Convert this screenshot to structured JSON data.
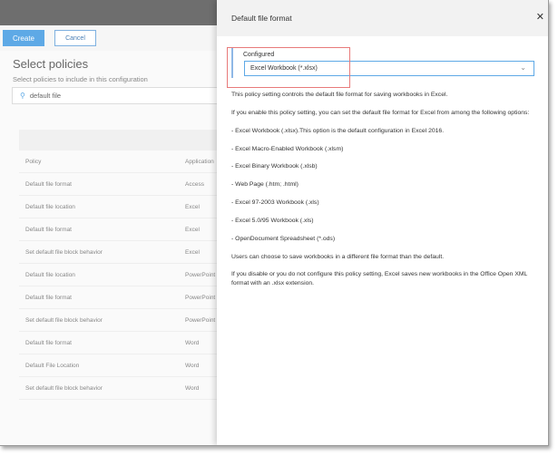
{
  "toolbar": {
    "create": "Create",
    "cancel": "Cancel"
  },
  "page": {
    "title": "Select policies",
    "subtitle": "Select policies to include in this configuration",
    "search_value": "default file"
  },
  "table": {
    "headers": [
      "Policy",
      "Application"
    ],
    "rows": [
      [
        "Default file format",
        "Access"
      ],
      [
        "Default file location",
        "Excel"
      ],
      [
        "Default file format",
        "Excel"
      ],
      [
        "Set default file block behavior",
        "Excel"
      ],
      [
        "Default file location",
        "PowerPoint"
      ],
      [
        "Default file format",
        "PowerPoint"
      ],
      [
        "Set default file block behavior",
        "PowerPoint"
      ],
      [
        "Default file format",
        "Word"
      ],
      [
        "Default File Location",
        "Word"
      ],
      [
        "Set default file block behavior",
        "Word"
      ]
    ]
  },
  "panel": {
    "title": "Default file format",
    "close": "✕",
    "config_label": "Configured",
    "selected": "Excel Workbook (*.xlsx)",
    "paragraphs": [
      "This policy setting controls the default file format for saving workbooks in Excel.",
      "If you enable this policy setting, you can set the default file format for Excel from among the following options:",
      "- Excel Workbook (.xlsx).This option is the default configuration in Excel 2016.",
      "- Excel Macro-Enabled Workbook (.xlsm)",
      "- Excel Binary Workbook (.xlsb)",
      "- Web Page (.htm; .html)",
      "- Excel 97-2003 Workbook (.xls)",
      "- Excel 5.0/95 Workbook (.xls)",
      "- OpenDocument Spreadsheet (*.ods)",
      "Users can choose to save workbooks in a different file format than the default.",
      "If you disable or you do not configure this policy setting, Excel saves new workbooks in the Office Open XML format with an .xlsx extension."
    ]
  },
  "colors": {
    "accent": "#5ea9e6",
    "highlight": "#e87a7a"
  }
}
